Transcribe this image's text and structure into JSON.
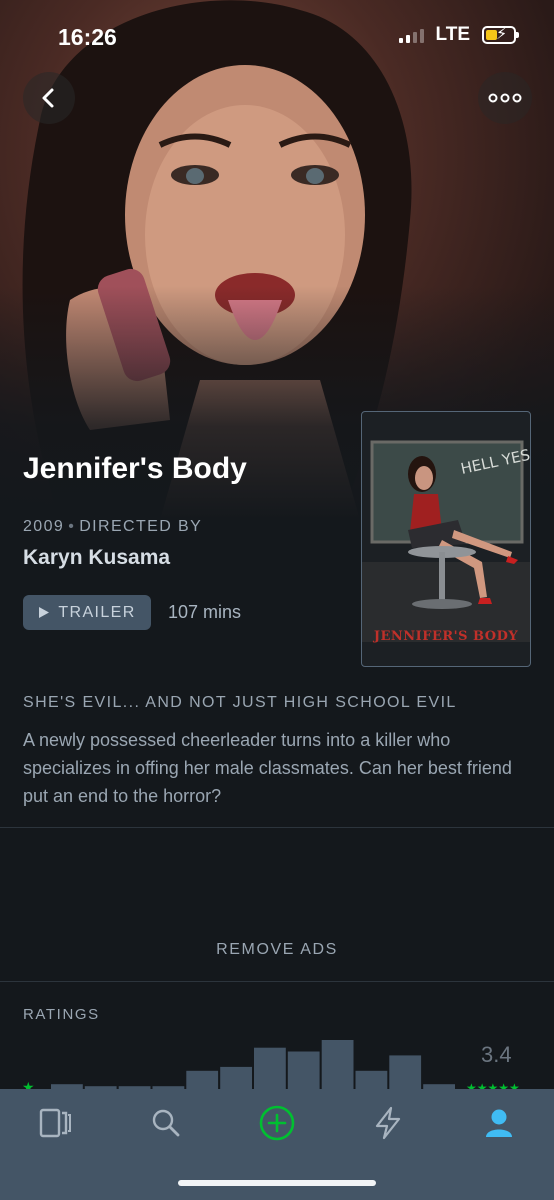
{
  "status_bar": {
    "time": "16:26",
    "network": "LTE",
    "battery_fill": 0.4,
    "signal_bars_active": 2,
    "signal_bars_total": 4
  },
  "nav": {
    "back_icon": "chevron-left-icon",
    "more_icon": "ellipsis-icon"
  },
  "film": {
    "title": "Jennifer's Body",
    "year": "2009",
    "directed_by_label": "DIRECTED BY",
    "director": "Karyn Kusama",
    "trailer_label": "TRAILER",
    "runtime": "107 mins",
    "poster_title": "JENNIFER'S BODY",
    "poster_chalk_text": "HELL YES!",
    "tagline": "SHE'S EVIL... AND NOT JUST HIGH SCHOOL EVIL",
    "synopsis": "A newly possessed cheerleader turns into a killer who specializes in offing her male classmates. Can her best friend put an end to the horror?"
  },
  "remove_ads_label": "REMOVE ADS",
  "ratings": {
    "heading": "RATINGS",
    "average": "3.4",
    "histogram": [
      0.03,
      0.02,
      0.02,
      0.02,
      0.1,
      0.12,
      0.22,
      0.2,
      0.26,
      0.1,
      0.18,
      0.03
    ],
    "bar_color": "#445566",
    "star_color": "#00c030"
  },
  "tabs": [
    {
      "name": "films",
      "icon": "films-icon",
      "active": false
    },
    {
      "name": "search",
      "icon": "search-icon",
      "active": false
    },
    {
      "name": "add",
      "icon": "add-icon",
      "active": false
    },
    {
      "name": "activity",
      "icon": "lightning-icon",
      "active": false
    },
    {
      "name": "profile",
      "icon": "profile-icon",
      "active": true
    }
  ],
  "colors": {
    "background": "#14181c",
    "tab_bar": "#445566",
    "accent_green": "#00c030",
    "accent_blue": "#40bcf4",
    "muted_text": "#9aa6b2"
  }
}
